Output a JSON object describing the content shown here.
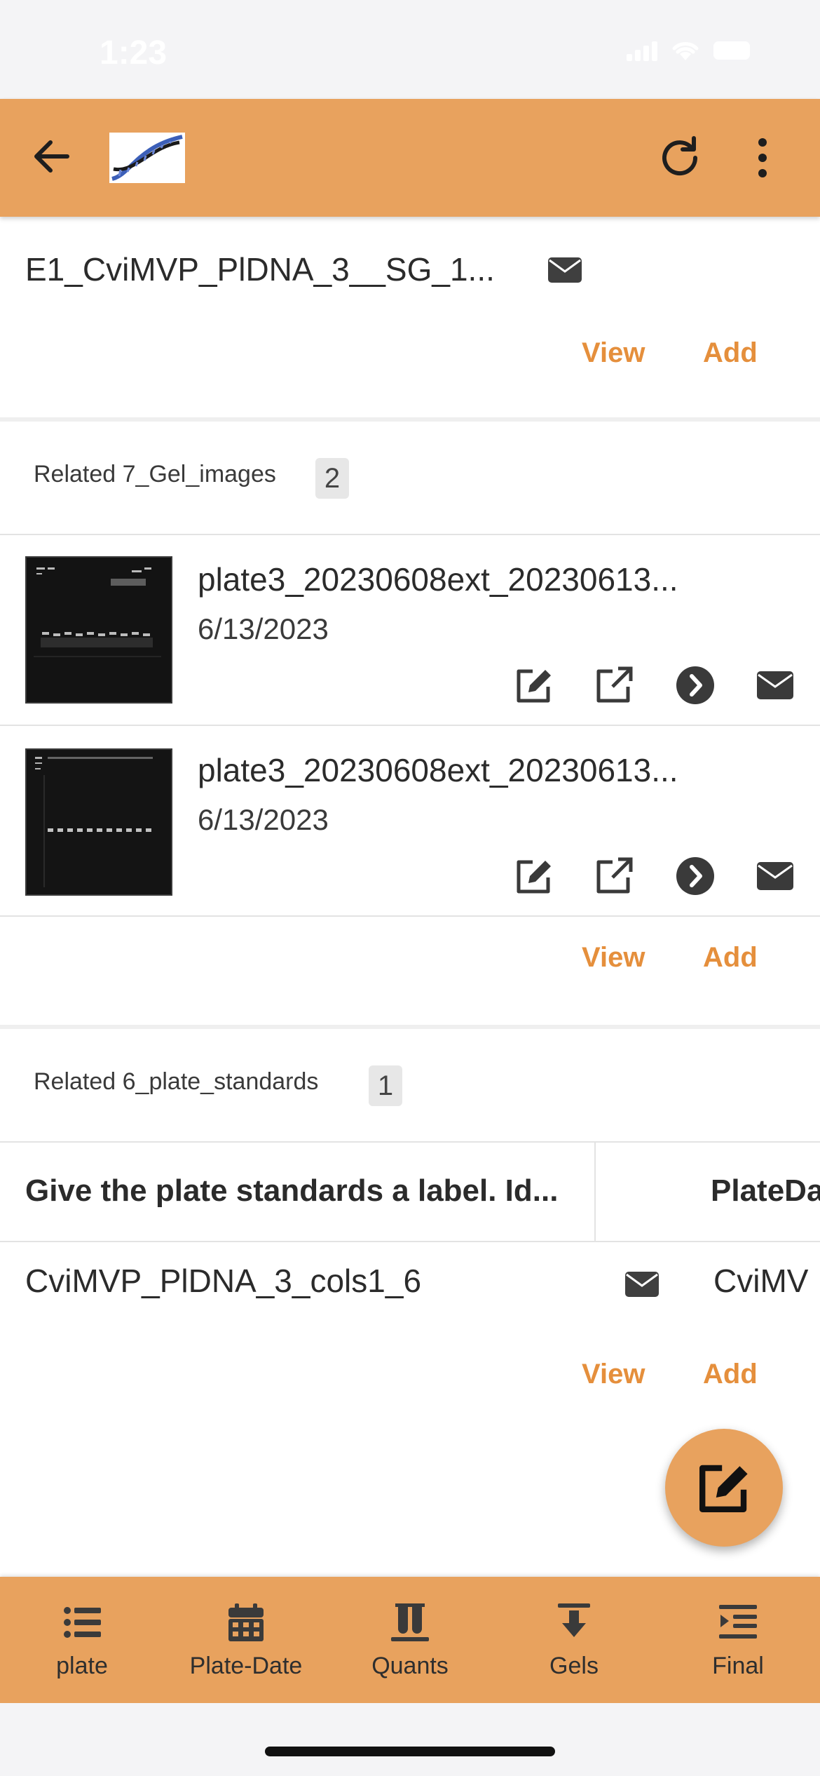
{
  "status_bar": {
    "time": "1:23"
  },
  "header": {
    "back_icon": "arrow-left-icon",
    "logo": "dna-helix-logo",
    "refresh_icon": "refresh-icon",
    "more_icon": "more-vertical-icon"
  },
  "top_record": {
    "name": "E1_CviMVP_PlDNA_3__SG_1...",
    "view_label": "View",
    "add_label": "Add"
  },
  "gel_images": {
    "label": "Related 7_Gel_images",
    "count": "2",
    "items": [
      {
        "name": "plate3_20230608ext_20230613...",
        "date": "6/13/2023"
      },
      {
        "name": "plate3_20230608ext_20230613...",
        "date": "6/13/2023"
      }
    ],
    "view_label": "View",
    "add_label": "Add"
  },
  "plate_standards": {
    "label": "Related 6_plate_standards",
    "count": "1",
    "columns": [
      "Give the plate standards a label. Id...",
      "PlateDa"
    ],
    "rows": [
      {
        "label": "CviMVP_PlDNA_3_cols1_6",
        "plate": "CviMV"
      }
    ],
    "view_label": "View",
    "add_label": "Add"
  },
  "bottom_nav": [
    {
      "label": "plate",
      "icon": "list-icon"
    },
    {
      "label": "Plate-Date",
      "icon": "calendar-icon"
    },
    {
      "label": "Quants",
      "icon": "test-tubes-icon"
    },
    {
      "label": "Gels",
      "icon": "download-arrow-icon"
    },
    {
      "label": "Final",
      "icon": "indent-list-icon"
    }
  ],
  "colors": {
    "accent": "#e8a25e",
    "link": "#e58f3c",
    "icon_dark": "#3a3a3a"
  }
}
